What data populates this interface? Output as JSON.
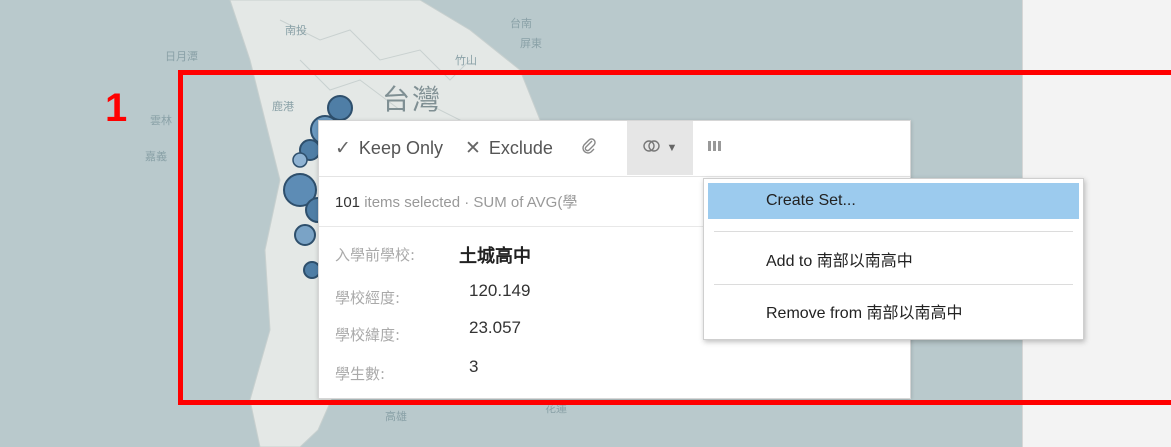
{
  "map": {
    "region_label": "台灣",
    "place_labels": [
      "日月潭",
      "雲林",
      "嘉義",
      "南投",
      "高雄",
      "台南",
      "屏東",
      "竹山",
      "鹿港",
      "花蓮"
    ],
    "colors": {
      "water": "#b9c9cc",
      "land": "#e4e8e6",
      "point": "#4f7ea6"
    }
  },
  "tooltip": {
    "keep_only_label": "Keep Only",
    "keep_only_icon": "check-icon",
    "exclude_label": "Exclude",
    "exclude_icon": "x-icon",
    "group_icon": "paperclip-icon",
    "set_icon": "venn-icon",
    "view_data_icon": "view-data-icon",
    "selection_count": "101",
    "selection_text": "items selected",
    "sum_text": "· SUM of AVG(學",
    "fields": [
      {
        "label": "入學前學校:",
        "value": "土城高中"
      },
      {
        "label": "學校經度:",
        "value": "120.149"
      },
      {
        "label": "學校緯度:",
        "value": "23.057"
      },
      {
        "label": "學生數:",
        "value": "3"
      }
    ]
  },
  "set_menu": {
    "items": [
      "Create Set...",
      "Add to 南部以南高中",
      "Remove from 南部以南高中"
    ],
    "highlight_color": "#9ccbee"
  },
  "annotation": {
    "step_number": "1",
    "color": "#ff0000"
  }
}
